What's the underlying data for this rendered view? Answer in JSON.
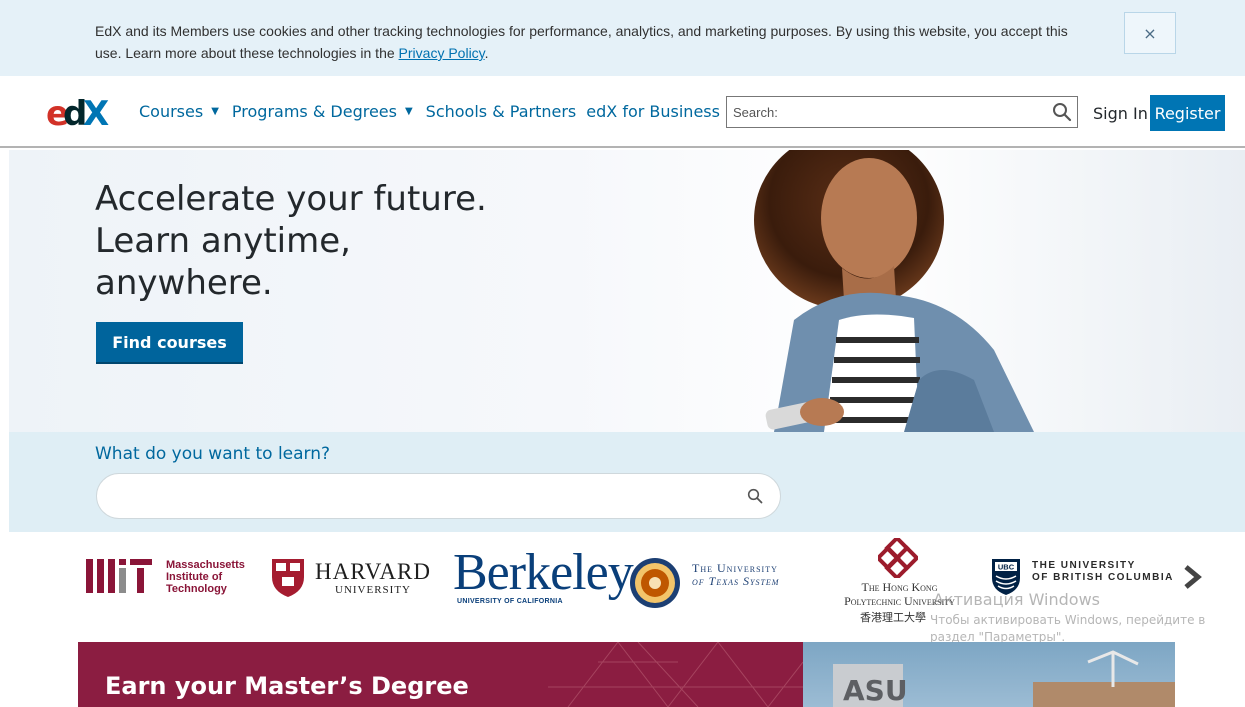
{
  "cookie_banner": {
    "text": "EdX and its Members use cookies and other tracking technologies for performance, analytics, and marketing purposes. By using this website, you accept this use. Learn more about these technologies in the ",
    "link": "Privacy Policy",
    "end": ".",
    "close": "×"
  },
  "header": {
    "logo": "edX",
    "nav": [
      {
        "label": "Courses",
        "dropdown": true
      },
      {
        "label": "Programs & Degrees",
        "dropdown": true
      },
      {
        "label": "Schools & Partners",
        "dropdown": false
      },
      {
        "label": "edX for Business",
        "dropdown": false
      }
    ],
    "search_placeholder": "Search:",
    "sign_in": "Sign In",
    "register": "Register"
  },
  "hero": {
    "title": "Accelerate your future. Learn anytime, anywhere.",
    "button": "Find courses"
  },
  "learn": {
    "label": "What do you want to learn?",
    "placeholder": ""
  },
  "partners": {
    "mit": "Massachusetts Institute of Technology",
    "mit_lines": [
      "Massachusetts",
      "Institute of",
      "Technology"
    ],
    "harvard": "HARVARD",
    "harvard_sub": "UNIVERSITY",
    "berkeley": "Berkeley",
    "berkeley_sub": "UNIVERSITY OF CALIFORNIA",
    "ut_line1": "The University",
    "ut_line2": "of Texas System",
    "hk_line1": "The Hong Kong",
    "hk_line2": "Polytechnic University",
    "hk_cn": "香港理工大學",
    "ubc_line1": "THE UNIVERSITY",
    "ubc_line2": "OF BRITISH COLUMBIA"
  },
  "promo": {
    "title": "Earn your Master’s Degree"
  },
  "watermark": {
    "line1": "Активация Windows",
    "line2": "Чтобы активировать Windows, перейдите в",
    "line3": "раздел \"Параметры\"."
  },
  "colors": {
    "brand_blue": "#0075b4",
    "nav_blue": "#00689e",
    "promo_maroon": "#8b1d41",
    "mit_red": "#8a1538",
    "berkeley_blue": "#0a3f7a"
  }
}
